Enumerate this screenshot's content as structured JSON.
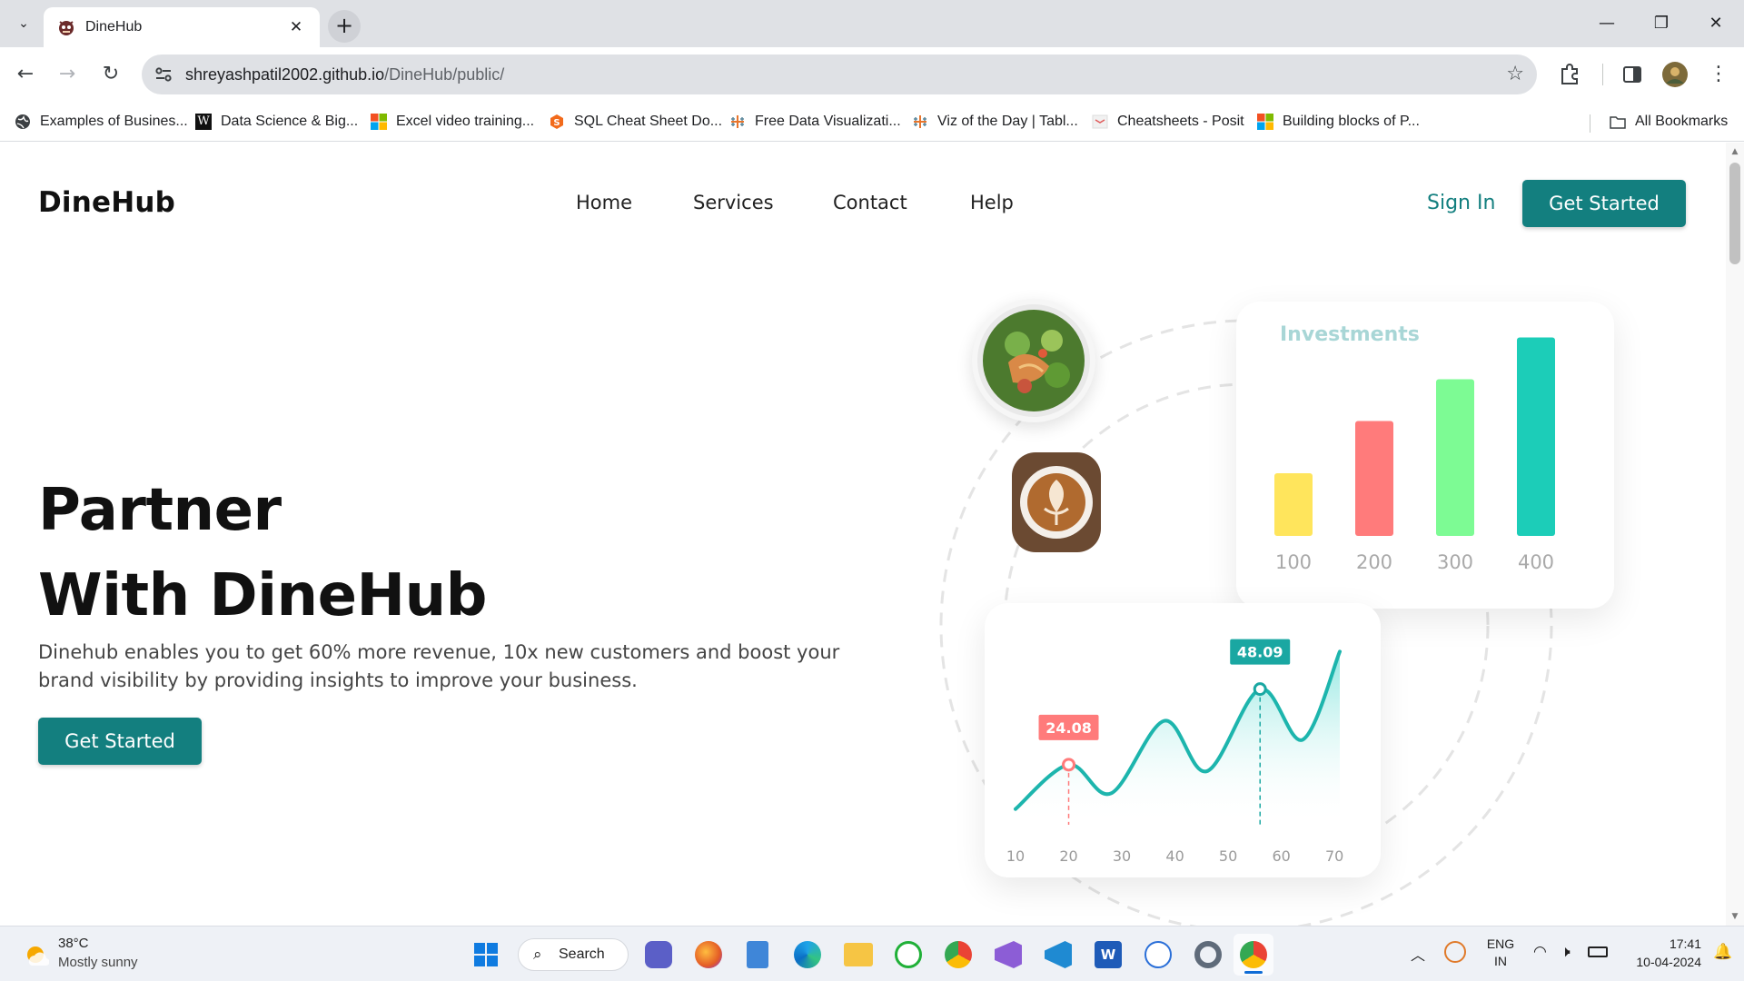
{
  "browser": {
    "tab": {
      "title": "DineHub",
      "close_icon": "✕",
      "favicon": "dinehub-mascot-icon"
    },
    "new_tab_symbol": "+",
    "tab_menu_symbol": "⌄",
    "window_controls": {
      "minimize": "—",
      "restore": "❐",
      "close": "✕"
    },
    "url_host": "shreyashpatil2002.github.io",
    "url_path": "/DineHub/public/",
    "bookmarks": [
      {
        "label": "Examples of Busines...",
        "icon": "globe-icon"
      },
      {
        "label": "Data Science & Big...",
        "icon": "w-logo-icon"
      },
      {
        "label": "Excel video training...",
        "icon": "microsoft-logo-icon"
      },
      {
        "label": "SQL Cheat Sheet Do...",
        "icon": "s-logo-icon"
      },
      {
        "label": "Free Data Visualizati...",
        "icon": "tableau-icon"
      },
      {
        "label": "Viz of the Day | Tabl...",
        "icon": "tableau-icon"
      },
      {
        "label": "Cheatsheets - Posit",
        "icon": "posit-icon"
      },
      {
        "label": "Building blocks of P...",
        "icon": "microsoft-logo-icon"
      }
    ],
    "all_bookmarks": "All Bookmarks"
  },
  "site": {
    "logo": "DineHub",
    "nav": [
      "Home",
      "Services",
      "Contact",
      "Help"
    ],
    "sign_in": "Sign In",
    "header_cta": "Get Started",
    "hero": {
      "line1": "Partner",
      "line2": "With DineHub",
      "description_1": "Dinehub enables you to get 60% more revenue, 10x new customers and boost your",
      "description_2": "brand visibility by providing insights to improve your business.",
      "cta": "Get Started"
    }
  },
  "chart_data": [
    {
      "type": "bar",
      "title": "Investments",
      "categories": [
        "100",
        "200",
        "300",
        "400"
      ],
      "values": [
        30,
        55,
        75,
        95
      ],
      "ylim": [
        0,
        100
      ],
      "colors": [
        "#ffe55c",
        "#ff7b7b",
        "#7dfb94",
        "#1ccdb8"
      ]
    },
    {
      "type": "area",
      "x_ticks": [
        10,
        20,
        30,
        40,
        50,
        60,
        70
      ],
      "x": [
        10,
        20,
        28,
        38,
        46,
        56,
        64,
        71
      ],
      "y": [
        10,
        24.08,
        15,
        38,
        22,
        48.09,
        32,
        60
      ],
      "xlim": [
        10,
        71
      ],
      "ylim": [
        5,
        65
      ],
      "annotations": [
        {
          "x": 20,
          "y": 24.08,
          "label": "24.08",
          "color": "#ff7b7b"
        },
        {
          "x": 56,
          "y": 48.09,
          "label": "48.09",
          "color": "#1aa7a2"
        }
      ],
      "line_color": "#1db5ad"
    }
  ],
  "taskbar": {
    "weather_temp": "38°C",
    "weather_desc": "Mostly sunny",
    "search_label": "Search",
    "lang_line1": "ENG",
    "lang_line2": "IN",
    "time": "17:41",
    "date": "10-04-2024"
  }
}
